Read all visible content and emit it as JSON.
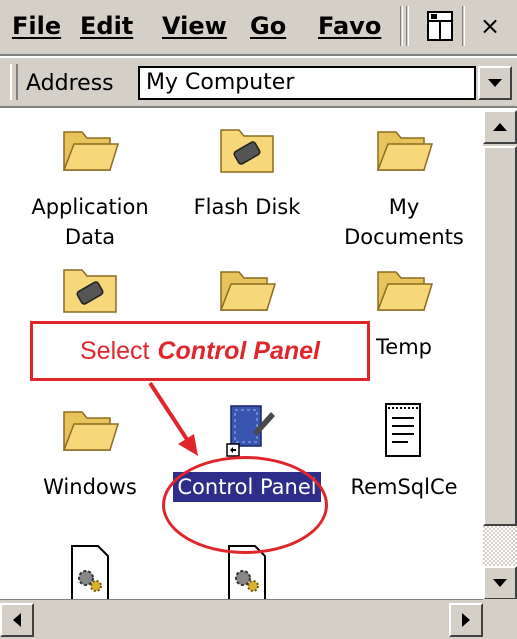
{
  "menubar": {
    "file": "File",
    "edit": "Edit",
    "view": "View",
    "go": "Go",
    "favorites": "Favo",
    "close_glyph": "×"
  },
  "address": {
    "label": "Address",
    "value": "My Computer"
  },
  "items": [
    {
      "label": "Application Data",
      "icon": "folder-icon"
    },
    {
      "label": "Flash Disk",
      "icon": "storage-folder-icon"
    },
    {
      "label": "My Documents",
      "icon": "folder-icon"
    },
    {
      "label": "",
      "icon": "storage-folder-icon"
    },
    {
      "label": "",
      "icon": "folder-icon"
    },
    {
      "label": "Temp",
      "icon": "folder-icon"
    },
    {
      "label": "Windows",
      "icon": "folder-icon"
    },
    {
      "label": "Control Panel",
      "icon": "control-panel-icon",
      "selected": true
    },
    {
      "label": "RemSqlCe",
      "icon": "document-icon"
    },
    {
      "label": "",
      "icon": "gear-file-icon"
    },
    {
      "label": "",
      "icon": "gear-file-icon"
    }
  ],
  "annotation": {
    "prefix": "Select",
    "target": "Control Panel",
    "color": "#e0262b"
  },
  "colors": {
    "chrome": "#d4d0c8",
    "selection": "#2e2e8a",
    "folder": "#f6d77a"
  }
}
